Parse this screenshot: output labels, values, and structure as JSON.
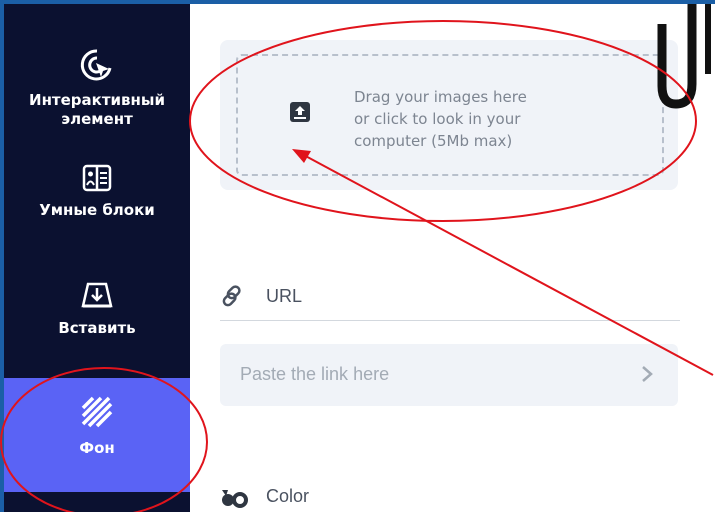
{
  "sidebar": {
    "items": [
      {
        "label": "Интерактивный элемент",
        "icon": "cursor-click-icon"
      },
      {
        "label": "Умные блоки",
        "icon": "smart-blocks-icon"
      },
      {
        "label": "Вставить",
        "icon": "insert-icon"
      },
      {
        "label": "Фон",
        "icon": "background-stripes-icon",
        "active": true
      }
    ]
  },
  "upload": {
    "text": "Drag your images here\nor click to look in your\ncomputer (5Mb max)",
    "icon": "upload-icon"
  },
  "url": {
    "label": "URL",
    "icon": "link-icon",
    "placeholder": "Paste the link here"
  },
  "color": {
    "label": "Color",
    "icon": "color-icon"
  },
  "colors": {
    "sidebar_bg": "#0b1130",
    "active_item": "#5a63f5",
    "annotation_red": "#e0141c",
    "frame_blue": "#1b5fa6"
  }
}
